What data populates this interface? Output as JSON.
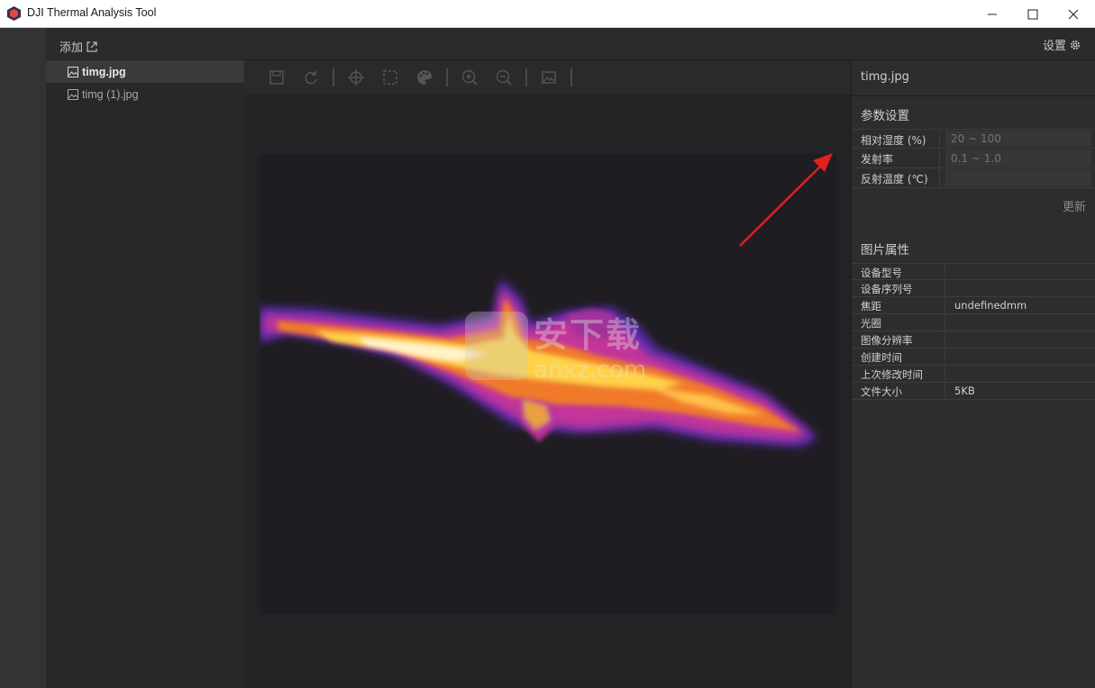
{
  "window": {
    "title": "DJI Thermal Analysis Tool"
  },
  "topbar": {
    "add_label": "添加",
    "settings_label": "设置"
  },
  "files": [
    {
      "name": "timg.jpg",
      "active": true
    },
    {
      "name": "timg (1).jpg",
      "active": false
    }
  ],
  "toolbar": {
    "tools": [
      "save-icon",
      "refresh-icon",
      "crosshair-icon",
      "select-rect-icon",
      "palette-icon",
      "zoom-in-icon",
      "zoom-out-icon",
      "image-icon"
    ]
  },
  "watermark": {
    "big": "安下载",
    "small": "anxz.com"
  },
  "panel": {
    "filename": "timg.jpg",
    "params_title": "参数设置",
    "params": [
      {
        "label": "相对湿度 (%)",
        "placeholder": "20 ~ 100"
      },
      {
        "label": "发射率",
        "placeholder": "0.1 ~ 1.0"
      },
      {
        "label": "反射温度 (℃)",
        "placeholder": ""
      }
    ],
    "update_label": "更新",
    "props_title": "图片属性",
    "props": [
      {
        "label": "设备型号",
        "value": ""
      },
      {
        "label": "设备序列号",
        "value": ""
      },
      {
        "label": "焦距",
        "value": "undefinedmm"
      },
      {
        "label": "光圈",
        "value": ""
      },
      {
        "label": "图像分辨率",
        "value": ""
      },
      {
        "label": "创建时间",
        "value": ""
      },
      {
        "label": "上次修改时间",
        "value": ""
      },
      {
        "label": "文件大小",
        "value": "5KB"
      }
    ]
  },
  "colors": {
    "accent_arrow": "#e0201a",
    "panel_bg": "#2d2d30"
  }
}
